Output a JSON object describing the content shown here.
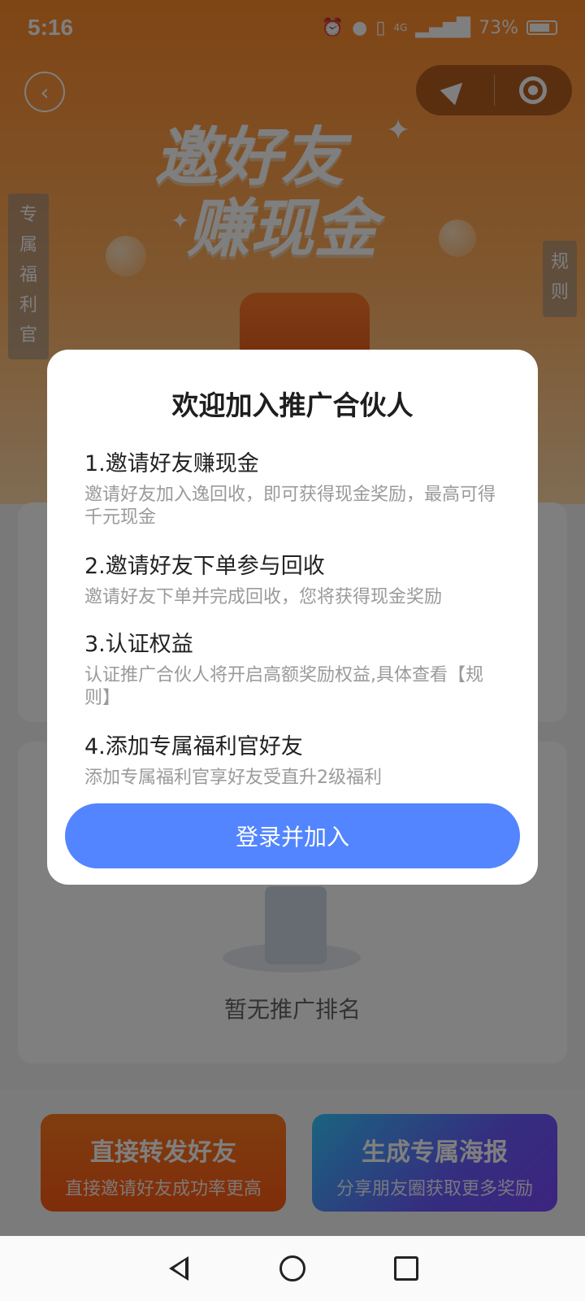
{
  "status_bar": {
    "time": "5:16",
    "network": "4G",
    "battery_percent": "73%"
  },
  "header": {
    "back_icon": "chevron-left-icon"
  },
  "hero": {
    "title_line1": "邀好友",
    "title_line2": "赚现金"
  },
  "side_tabs": {
    "left_label": "专属福利官",
    "right_label": "规则"
  },
  "background": {
    "rank_empty_text": "暂无推广排名",
    "cta_left": {
      "title": "直接转发好友",
      "subtitle": "直接邀请好友成功率更高"
    },
    "cta_right": {
      "title": "生成专属海报",
      "subtitle": "分享朋友圈获取更多奖励"
    }
  },
  "modal": {
    "title": "欢迎加入推广合伙人",
    "items": [
      {
        "title": "1.邀请好友赚现金",
        "desc": "邀请好友加入逸回收，即可获得现金奖励，最高可得千元现金"
      },
      {
        "title": "2.邀请好友下单参与回收",
        "desc": "邀请好友下单并完成回收，您将获得现金奖励"
      },
      {
        "title": "3.认证权益",
        "desc": "认证推广合伙人将开启高额奖励权益,具体查看【规则】"
      },
      {
        "title": "4.添加专属福利官好友",
        "desc": "添加专属福利官享好友受直升2级福利"
      }
    ],
    "button_label": "登录并加入"
  },
  "colors": {
    "primary_button": "#5285ff",
    "hero_orange": "#ff8a2a"
  }
}
